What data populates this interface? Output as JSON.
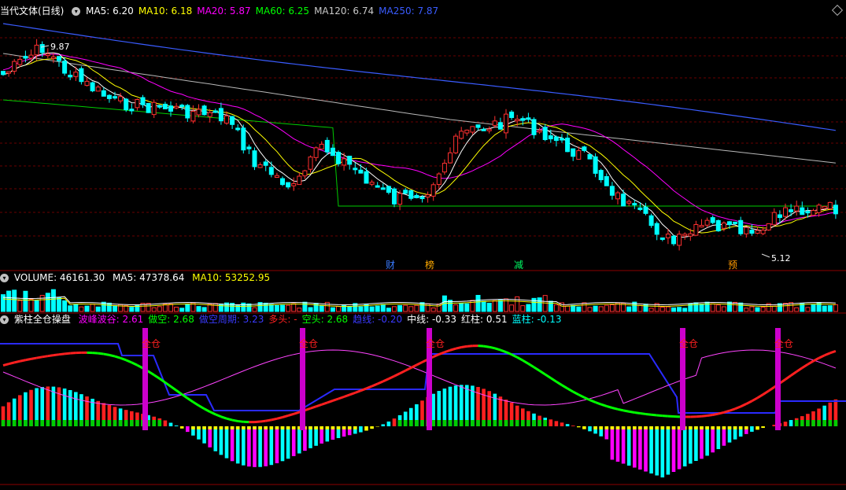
{
  "main_chart": {
    "title": "当代文体(日线)",
    "indicators": [
      {
        "label": "MA5: 6.20",
        "color": "#ffffff"
      },
      {
        "label": "MA10: 6.18",
        "color": "#ffff00"
      },
      {
        "label": "MA20: 5.87",
        "color": "#ff00ff"
      },
      {
        "label": "MA60: 6.25",
        "color": "#00ff00"
      },
      {
        "label": "MA120: 6.74",
        "color": "#c8c8c8"
      },
      {
        "label": "MA250: 7.87",
        "color": "#3a5cff"
      }
    ],
    "high_label": "9.87",
    "low_label": "5.12",
    "event_labels": [
      {
        "text": "财",
        "color": "#3a7bff"
      },
      {
        "text": "榜",
        "color": "#ffaa00"
      },
      {
        "text": "减",
        "color": "#00ff66"
      },
      {
        "text": "预",
        "color": "#ff9900"
      }
    ]
  },
  "volume_panel": {
    "title": "VOLUME: 46161.30",
    "ma5": "MA5: 47378.64",
    "ma10": "MA10: 53252.95"
  },
  "indicator_panel": {
    "title": "紫柱全仓操盘",
    "items": [
      {
        "label": "波峰波谷: 2.61",
        "color": "#ff00ff"
      },
      {
        "label": "做空: 2.68",
        "color": "#00ff00"
      },
      {
        "label": "做空周期: 3.23",
        "color": "#3a3aff"
      },
      {
        "label": "多头: -",
        "color": "#ff2020"
      },
      {
        "label": "空头: 2.68",
        "color": "#00ff00"
      },
      {
        "label": "趋线: -0.20",
        "color": "#3a3aff"
      },
      {
        "label": "中线: -0.33",
        "color": "#ffffff"
      },
      {
        "label": "红柱: 0.51",
        "color": "#ffffff"
      },
      {
        "label": "蓝柱: -0.13",
        "color": "#00ffff"
      }
    ],
    "signal_label": "全仓"
  },
  "chart_data": {
    "type": "candlestick",
    "title": "当代文体(日线)",
    "price_high": 9.87,
    "price_low": 5.12,
    "last_close": 6.2,
    "moving_averages": {
      "MA5": 6.2,
      "MA10": 6.18,
      "MA20": 5.87,
      "MA60": 6.25,
      "MA120": 6.74,
      "MA250": 7.87
    },
    "volume": {
      "VOLUME": 46161.3,
      "MA5": 47378.64,
      "MA10": 53252.95
    },
    "indicator": {
      "name": "紫柱全仓操盘",
      "波峰波谷": 2.61,
      "做空": 2.68,
      "做空周期": 3.23,
      "空头": 2.68,
      "趋线": -0.2,
      "中线": -0.33,
      "红柱": 0.51,
      "蓝柱": -0.13
    },
    "signals": [
      "全仓",
      "全仓",
      "全仓",
      "全仓",
      "全仓"
    ]
  }
}
